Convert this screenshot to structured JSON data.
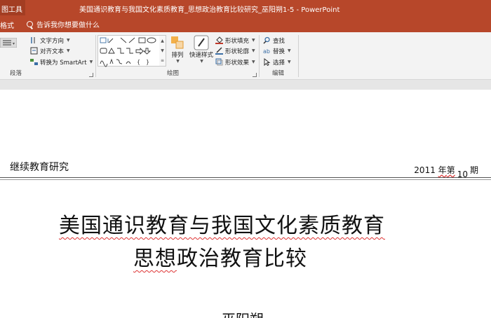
{
  "titlebar": {
    "tool_tab": "图工具",
    "title": "美国通识教育与我国文化素质教育_思想政治教育比较研究_巫阳朔1-5  -  PowerPoint"
  },
  "tabs": {
    "format": "格式",
    "tell_me": "告诉我你想要做什么"
  },
  "ribbon": {
    "paragraph": {
      "text_direction": "文字方向",
      "align_text": "对齐文本",
      "convert_smartart": "转换为 SmartArt",
      "label": "段落"
    },
    "drawing": {
      "arrange": "排列",
      "quick_styles": "快速样式",
      "shape_fill": "形状填充",
      "shape_outline": "形状轮廓",
      "shape_effects": "形状效果",
      "label": "绘图"
    },
    "editing": {
      "find": "查找",
      "replace": "替换",
      "select": "选择",
      "label": "编辑"
    }
  },
  "document": {
    "journal": "继续教育研究",
    "issue_year": "2011",
    "issue_nian": "年",
    "issue_di": "第",
    "issue_number": "10",
    "issue_qi": "期",
    "title_line1": "美国通识教育与我国文化素质教育",
    "title_line2a": "思想",
    "title_line2b": "政治教育比较",
    "author": "巫阳朔"
  }
}
